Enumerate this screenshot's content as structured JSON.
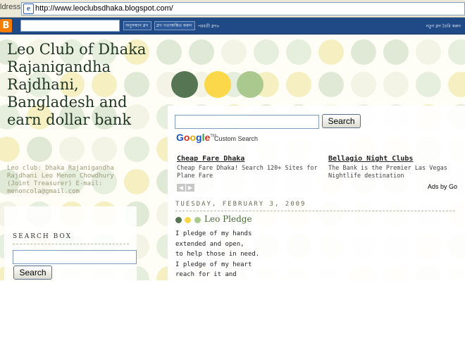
{
  "browser": {
    "address_label": "ldress",
    "url": "http://www.leoclubsdhaka.blogspot.com/"
  },
  "navbar": {
    "logo": "B",
    "search_button": "অনুসন্ধান ব্লগ",
    "flag_button": "ব্লগ পতাকাঙ্কিত করুন",
    "next_blog": "পরবর্তী ব্লগ»",
    "right_link": "নতুন ব্লগ তৈরি করুন"
  },
  "blog": {
    "title": "Leo Club of Dhaka Rajanigandha Rajdhani, Bangladesh and earn dollar bank",
    "description": "Leo club: Dhaka Rajanigandha Rajdhani Leo Menon Chowdhury (Joint Treasurer) E-mail: menoncola@gmail.com"
  },
  "sidebar": {
    "search_heading": "SEARCH BOX",
    "search_button": "Search"
  },
  "main": {
    "search_button": "Search",
    "google_logo": "Google",
    "custom_search": "Custom Search",
    "ads": [
      {
        "title": "Cheap Fare Dhaka",
        "text": "Cheap Fare Dhaka! Search 120+ Sites for Plane Fare"
      },
      {
        "title": "Bellagio Night Clubs",
        "text": "The Bank is the Premier Las Vegas Nightlife destination"
      }
    ],
    "ads_by": "Ads by Go",
    "date_header": "TUESDAY, FEBRUARY 3, 2009",
    "post": {
      "title": "Leo Pledge",
      "lines": [
        "I pledge of my hands",
        "extended and open,",
        "to help those in need.",
        "I pledge of my heart",
        "reach for it and"
      ]
    }
  },
  "colors": {
    "dot_dark": "#557553",
    "dot_yellow": "#fbd84a",
    "dot_light": "#a9c98f",
    "navbar": "#1f4a86"
  }
}
